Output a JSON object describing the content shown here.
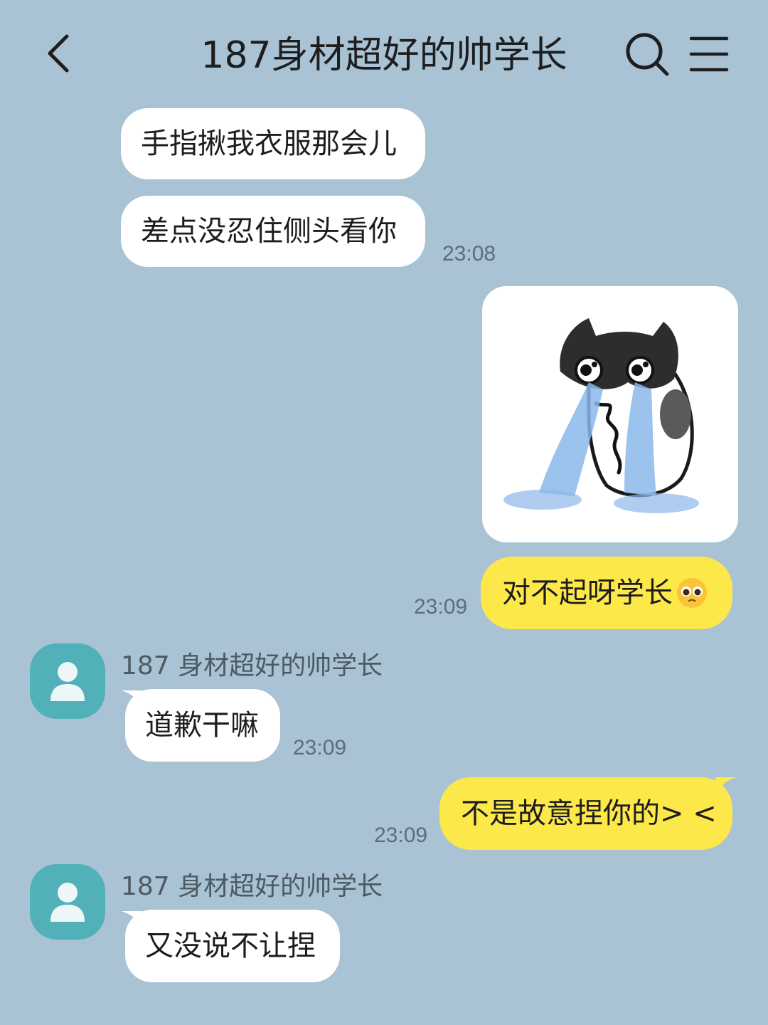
{
  "header": {
    "title": "187身材超好的帅学长",
    "back_icon": "chevron-left-icon",
    "search_icon": "search-icon",
    "menu_icon": "menu-icon"
  },
  "messages": [
    {
      "side": "in",
      "text": "手指揪我衣服那会儿"
    },
    {
      "side": "in",
      "text": "差点没忍住侧头看你",
      "time": "23:08"
    },
    {
      "side": "out",
      "type": "sticker",
      "sticker": "crying-cat-sticker"
    },
    {
      "side": "out",
      "text": "对不起呀学长",
      "emoji": "pleading-face-emoji",
      "time": "23:09"
    },
    {
      "side": "in",
      "sender": "187 身材超好的帅学长",
      "text": "道歉干嘛",
      "time": "23:09"
    },
    {
      "side": "out",
      "text": "不是故意捏你的> <",
      "time": "23:09"
    },
    {
      "side": "in",
      "sender": "187 身材超好的帅学长",
      "text": "又没说不让捏"
    }
  ],
  "colors": {
    "background": "#a9c3d4",
    "incoming_bubble": "#ffffff",
    "outgoing_bubble": "#fde84a",
    "avatar": "#52b0b8"
  }
}
